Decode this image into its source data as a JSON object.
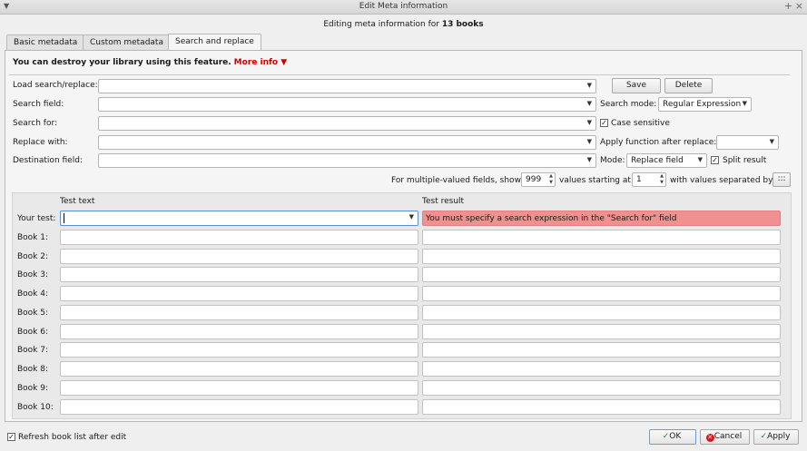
{
  "window": {
    "title": "Edit Meta information",
    "pin": "+",
    "close": "×"
  },
  "subtitle": {
    "prefix": "Editing meta information for ",
    "count": "13 books"
  },
  "tabs": [
    "Basic metadata",
    "Custom metadata",
    "Search and replace"
  ],
  "warning": {
    "text": "You can destroy your library using this feature.",
    "more": "More info"
  },
  "form": {
    "load_label": "Load search/replace:",
    "save": "Save",
    "delete": "Delete",
    "search_field_label": "Search field:",
    "search_mode_label": "Search mode:",
    "search_mode_value": "Regular Expression",
    "search_for_label": "Search for:",
    "case_sensitive": "Case sensitive",
    "replace_with_label": "Replace with:",
    "apply_function_label": "Apply function after replace:",
    "destination_label": "Destination field:",
    "mode_label": "Mode:",
    "mode_value": "Replace field",
    "split_result": "Split result",
    "multi_prefix": "For multiple-valued fields, show",
    "multi_count": "999",
    "multi_middle": "values starting at",
    "multi_start": "1",
    "multi_suffix": "with values separated by",
    "separator": ":::"
  },
  "test": {
    "col_text": "Test text",
    "col_result": "Test result",
    "your_test_label": "Your test:",
    "error": "You must specify a search expression in the \"Search for\" field",
    "books": [
      "Book 1:",
      "Book 2:",
      "Book 3:",
      "Book 4:",
      "Book 5:",
      "Book 6:",
      "Book 7:",
      "Book 8:",
      "Book 9:",
      "Book 10:"
    ]
  },
  "footer": {
    "refresh": "Refresh book list after edit",
    "ok": "OK",
    "cancel": "Cancel",
    "apply": "Apply"
  }
}
